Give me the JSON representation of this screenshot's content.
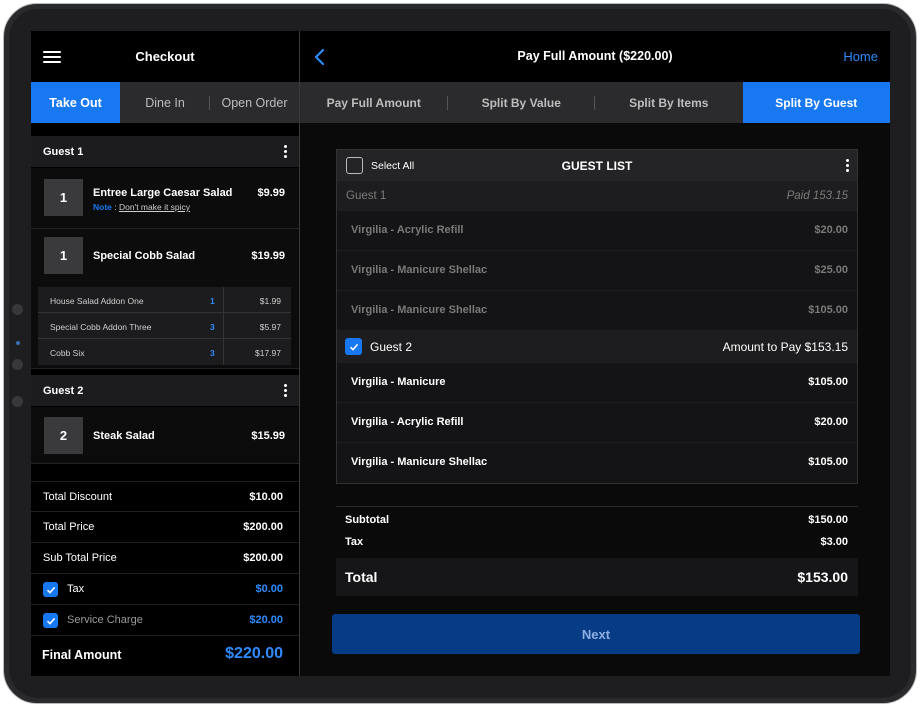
{
  "left": {
    "title": "Checkout",
    "order_tabs": [
      {
        "label": "Take Out",
        "active": true
      },
      {
        "label": "Dine In",
        "active": false
      },
      {
        "label": "Open Order",
        "active": false
      }
    ],
    "guest1": {
      "label": "Guest 1",
      "items": [
        {
          "qty": "1",
          "name": "Entree Large Caesar Salad",
          "price": "$9.99",
          "note_label": "Note",
          "note_sep": " : ",
          "note_value": "Don't make it spicy"
        },
        {
          "qty": "1",
          "name": "Special Cobb Salad",
          "price": "$19.99"
        }
      ],
      "addons": [
        {
          "name": "House Salad Addon One",
          "qty": "1",
          "price": "$1.99"
        },
        {
          "name": "Special Cobb Addon Three",
          "qty": "3",
          "price": "$5.97"
        },
        {
          "name": "Cobb Six",
          "qty": "3",
          "price": "$17.97"
        }
      ]
    },
    "guest2": {
      "label": "Guest 2",
      "items": [
        {
          "qty": "2",
          "name": "Steak Salad",
          "price": "$15.99"
        }
      ]
    },
    "summary": {
      "total_discount_label": "Total Discount",
      "total_discount": "$10.00",
      "total_price_label": "Total Price",
      "total_price": "$200.00",
      "sub_total_label": "Sub Total Price",
      "sub_total": "$200.00",
      "tax_label": "Tax",
      "tax": "$0.00",
      "service_label": "Service Charge",
      "service": "$20.00",
      "final_label": "Final Amount",
      "final": "$220.00"
    }
  },
  "right": {
    "title": "Pay Full Amount ($220.00)",
    "home_label": "Home",
    "split_tabs": [
      {
        "label": "Pay Full Amount",
        "active": false
      },
      {
        "label": "Split By Value",
        "active": false
      },
      {
        "label": "Split By Items",
        "active": false
      },
      {
        "label": "Split By Guest",
        "active": true
      }
    ],
    "guest_list": {
      "select_all_label": "Select All",
      "title": "GUEST LIST",
      "guest1": {
        "name": "Guest 1",
        "status": "Paid 153.15",
        "items": [
          {
            "name": "Virgilia - Acrylic Refill",
            "price": "$20.00"
          },
          {
            "name": "Virgilia - Manicure Shellac",
            "price": "$25.00"
          },
          {
            "name": "Virgilia - Manicure Shellac",
            "price": "$105.00"
          }
        ]
      },
      "guest2": {
        "name": "Guest 2",
        "amount_label": "Amount to  Pay  $153.15",
        "items": [
          {
            "name": "Virgilia - Manicure",
            "price": "$105.00"
          },
          {
            "name": "Virgilia - Acrylic Refill",
            "price": "$20.00"
          },
          {
            "name": "Virgilia - Manicure Shellac",
            "price": "$105.00"
          }
        ]
      }
    },
    "totals": {
      "subtotal_label": "Subtotal",
      "subtotal": "$150.00",
      "tax_label": "Tax",
      "tax": "$3.00",
      "total_label": "Total",
      "total": "$153.00"
    },
    "next_label": "Next"
  },
  "colors": {
    "accent": "#1778f2",
    "accent_text": "#2e8bff",
    "next_button": "#063b86",
    "background": "#000000"
  },
  "icons": [
    "hamburger-icon",
    "chevron-left-icon",
    "kebab-icon",
    "checkmark-icon"
  ]
}
